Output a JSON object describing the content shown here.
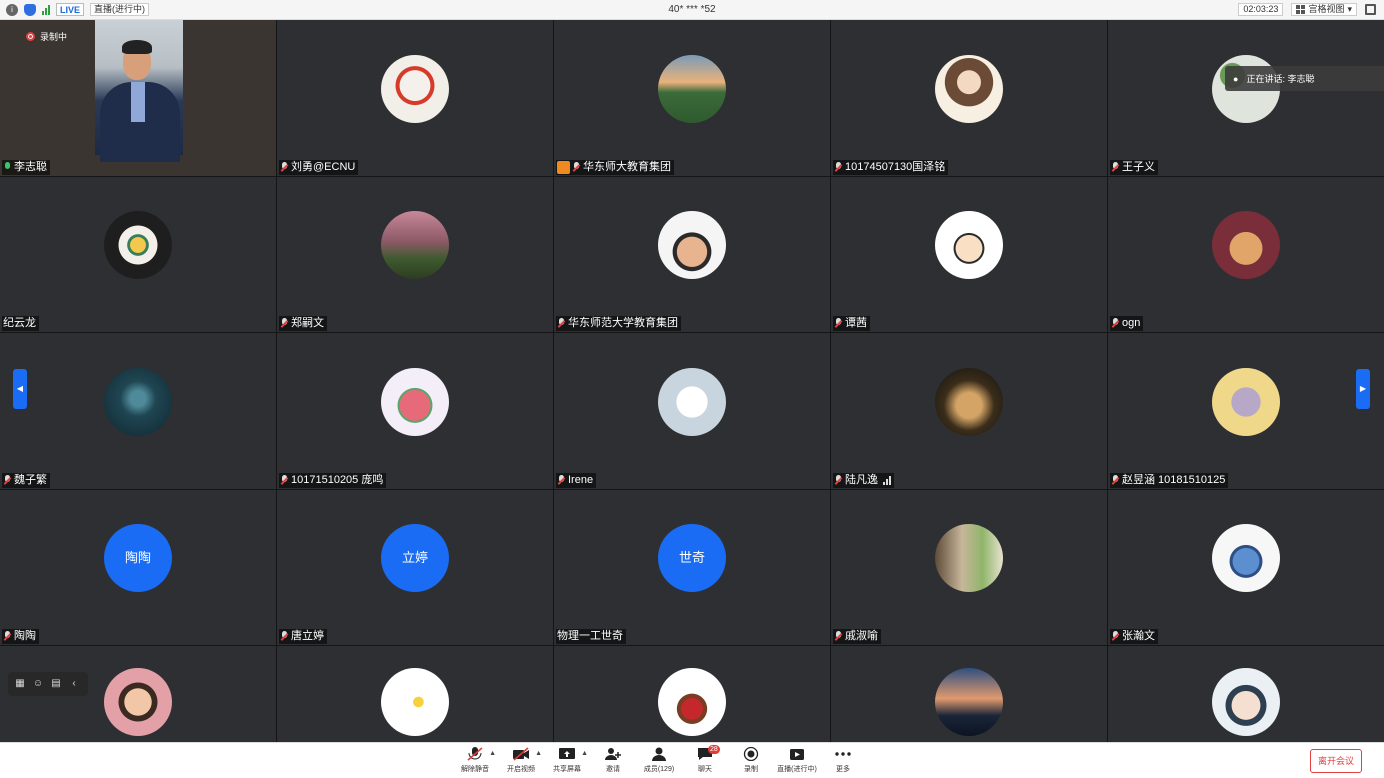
{
  "topbar": {
    "live_label": "LIVE",
    "live_status": "直播(进行中)",
    "meeting_id": "40* *** *52",
    "timer": "02:03:23",
    "view_label": "宫格视图"
  },
  "recording_label": "录制中",
  "speaking_label": "正在讲话: 李志聪",
  "participants": [
    {
      "name": "李志聪"
    },
    {
      "name": "刘勇@ECNU"
    },
    {
      "name": "华东师大教育集团"
    },
    {
      "name": "10174507130国泽铭"
    },
    {
      "name": "王子义"
    },
    {
      "name": "纪云龙"
    },
    {
      "name": "郑嗣文"
    },
    {
      "name": "华东师范大学教育集团"
    },
    {
      "name": "谭茜"
    },
    {
      "name": "ogn"
    },
    {
      "name": "魏子繁"
    },
    {
      "name": "10171510205 庞鸣"
    },
    {
      "name": "Irene"
    },
    {
      "name": "陆凡逸"
    },
    {
      "name": "赵昱涵 10181510125"
    },
    {
      "name": "陶陶",
      "avatar_text": "陶陶"
    },
    {
      "name": "唐立婷",
      "avatar_text": "立婷"
    },
    {
      "name": "物理一工世奇",
      "avatar_text": "世奇"
    },
    {
      "name": "戚淑喻"
    },
    {
      "name": "张瀚文"
    }
  ],
  "toolbar": {
    "unmute": "解除静音",
    "start_video": "开启视频",
    "share": "共享屏幕",
    "invite": "邀请",
    "members": "成员(129)",
    "chat": "聊天",
    "chat_badge": "28",
    "record": "录制",
    "live": "直播(进行中)",
    "more": "更多",
    "leave": "离开会议"
  }
}
